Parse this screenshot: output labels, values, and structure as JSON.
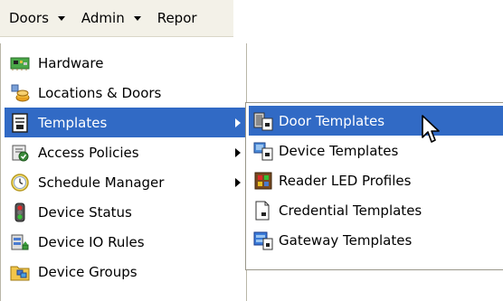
{
  "menubar": {
    "items": [
      {
        "label": "Doors"
      },
      {
        "label": "Admin"
      },
      {
        "label": "Repor"
      }
    ]
  },
  "menu": {
    "items": [
      {
        "label": "Hardware",
        "icon": "hardware-board-icon"
      },
      {
        "label": "Locations & Doors",
        "icon": "locations-icon"
      },
      {
        "label": "Templates",
        "icon": "template-document-icon",
        "selected": true,
        "has_submenu": true
      },
      {
        "label": "Access Policies",
        "icon": "access-policy-icon",
        "has_submenu": true
      },
      {
        "label": "Schedule Manager",
        "icon": "clock-icon",
        "has_submenu": true
      },
      {
        "label": "Device Status",
        "icon": "traffic-light-icon"
      },
      {
        "label": "Device IO Rules",
        "icon": "io-rules-icon"
      },
      {
        "label": "Device Groups",
        "icon": "device-groups-icon"
      }
    ]
  },
  "submenu": {
    "items": [
      {
        "label": "Door Templates",
        "icon": "door-template-icon",
        "selected": true
      },
      {
        "label": "Device Templates",
        "icon": "device-template-icon"
      },
      {
        "label": "Reader LED Profiles",
        "icon": "reader-led-icon"
      },
      {
        "label": "Credential Templates",
        "icon": "credential-template-icon"
      },
      {
        "label": "Gateway Templates",
        "icon": "gateway-template-icon"
      }
    ]
  },
  "colors": {
    "selection": "#316ac5",
    "menubar_bg": "#f3f1e8"
  }
}
